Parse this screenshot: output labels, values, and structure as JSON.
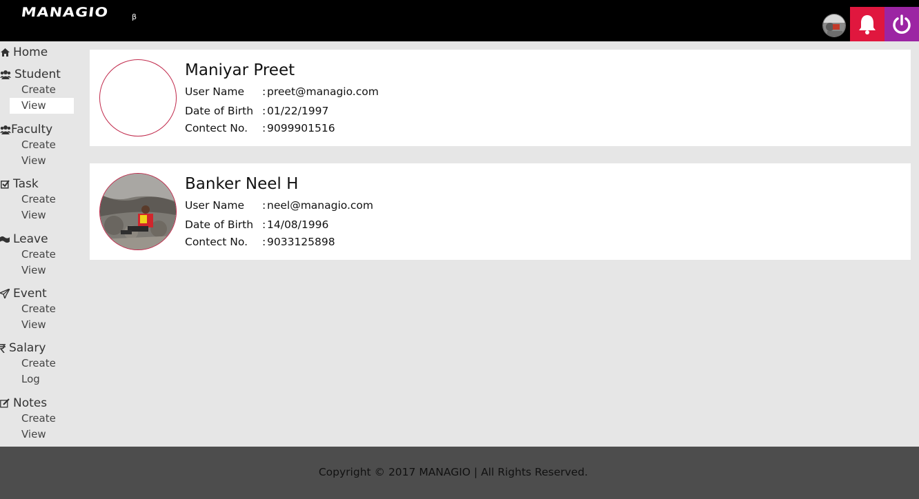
{
  "brand": {
    "logo": "MANAGIO",
    "beta": "β"
  },
  "colors": {
    "topbar": "#000000",
    "bell": "#e0173e",
    "power": "#9c25a3",
    "footer": "#4d4d4d",
    "avatar_border": "#c0284a"
  },
  "header": {
    "icons": [
      "user-avatar",
      "bell-icon",
      "power-icon"
    ]
  },
  "sidebar": {
    "home": {
      "label": "Home",
      "icon": "home-icon"
    },
    "sections": [
      {
        "label": "Student",
        "icon": "users-icon",
        "items": [
          "Create",
          "View"
        ]
      },
      {
        "label": "Faculty",
        "icon": "users-icon",
        "items": [
          "Create",
          "View"
        ]
      },
      {
        "label": "Task",
        "icon": "checkbox-icon",
        "items": [
          "Create",
          "View"
        ]
      },
      {
        "label": "Leave",
        "icon": "flag-icon",
        "items": [
          "Create",
          "View"
        ]
      },
      {
        "label": "Event",
        "icon": "paper-plane-icon",
        "items": [
          "Create",
          "View"
        ]
      },
      {
        "label": "Salary",
        "icon": "rupee-icon",
        "items": [
          "Create",
          "Log"
        ]
      },
      {
        "label": "Notes",
        "icon": "edit-icon",
        "items": [
          "Create",
          "View"
        ]
      }
    ]
  },
  "students": [
    {
      "name": "Maniyar Preet",
      "username_label": "User Name",
      "username": "preet@managio.com",
      "dob_label": "Date of Birth",
      "dob": "01/22/1997",
      "contact_label": "Contect No.",
      "contact": "9099901516",
      "colon": ":"
    },
    {
      "name": "Banker Neel H",
      "username_label": "User Name",
      "username": "neel@managio.com",
      "dob_label": "Date of Birth",
      "dob": "14/08/1996",
      "contact_label": "Contect No.",
      "contact": "9033125898",
      "colon": ":"
    }
  ],
  "footer": {
    "text": "Copyright © 2017 MANAGIO | All Rights Reserved."
  }
}
